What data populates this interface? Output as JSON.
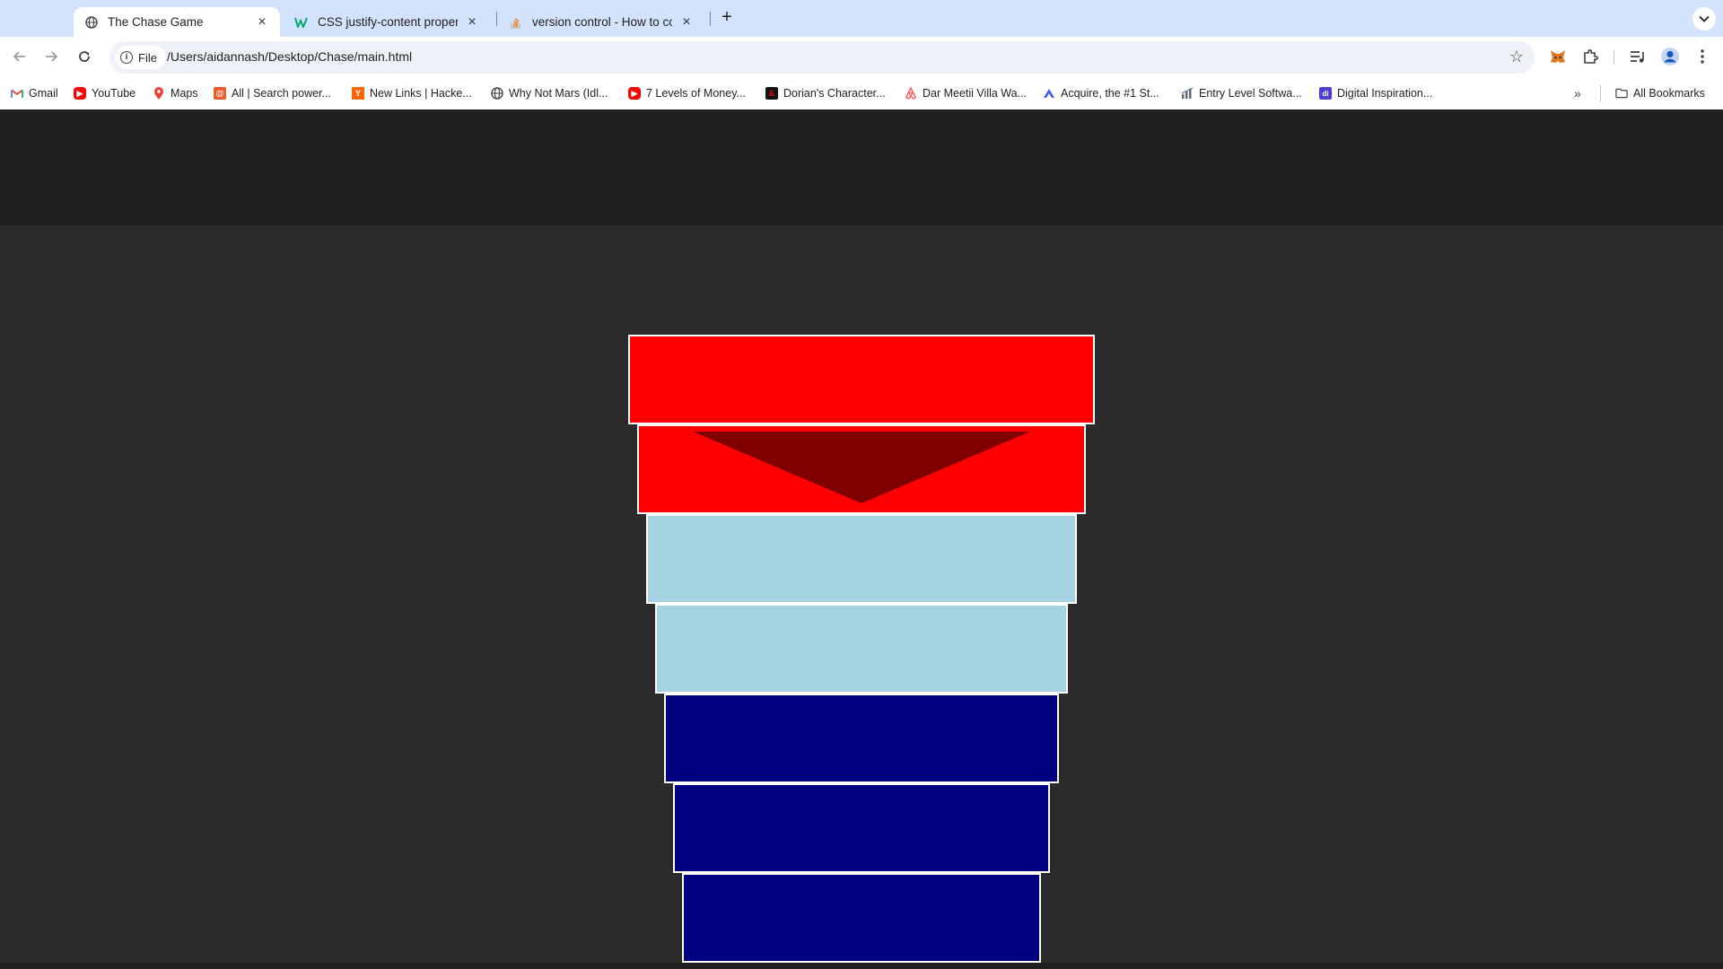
{
  "browser": {
    "tabs": [
      {
        "title": "The Chase Game",
        "active": true,
        "icon": "globe-icon"
      },
      {
        "title": "CSS justify-content property",
        "active": false,
        "icon": "w3schools-icon"
      },
      {
        "title": "version control - How to conn",
        "active": false,
        "icon": "stackoverflow-icon"
      }
    ],
    "omnibox": {
      "chip_label": "File",
      "url": "/Users/aidannash/Desktop/Chase/main.html"
    },
    "bookmarks": [
      {
        "label": "Gmail",
        "icon": "gmail-icon"
      },
      {
        "label": "YouTube",
        "icon": "youtube-icon"
      },
      {
        "label": "Maps",
        "icon": "maps-icon"
      },
      {
        "label": "All | Search power...",
        "icon": "search-power-icon"
      },
      {
        "label": "New Links | Hacke...",
        "icon": "hackernews-icon"
      },
      {
        "label": "Why Not Mars (Idl...",
        "icon": "globe-icon"
      },
      {
        "label": "7 Levels of Money...",
        "icon": "youtube-icon"
      },
      {
        "label": "Dorian's Character...",
        "icon": "dnd-icon"
      },
      {
        "label": "Dar Meetii Villa Wa...",
        "icon": "airbnb-icon"
      },
      {
        "label": "Acquire, the #1 St...",
        "icon": "acquire-icon"
      },
      {
        "label": "Entry Level Softwa...",
        "icon": "chart-icon"
      },
      {
        "label": "Digital Inspiration...",
        "icon": "di-icon"
      }
    ],
    "all_bookmarks_label": "All Bookmarks"
  },
  "game": {
    "colors": {
      "chaser": "#ff0000",
      "chaser_marker": "#800000",
      "gap": "#a5d2e0",
      "player": "#000080"
    },
    "board_levels": [
      "red",
      "red",
      "light",
      "light",
      "dark",
      "dark",
      "dark"
    ],
    "chaser_marker_level": 2
  }
}
